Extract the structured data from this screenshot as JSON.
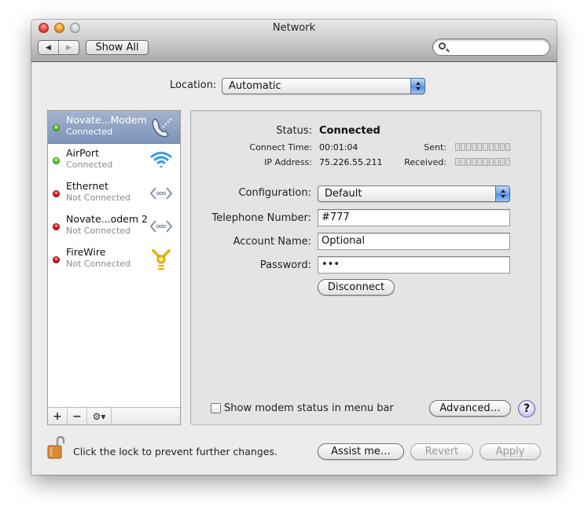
{
  "window": {
    "title": "Network",
    "controls": [
      "close",
      "minimize",
      "zoom"
    ]
  },
  "toolbar": {
    "back_icon": "◀",
    "forward_icon": "▶",
    "show_all_label": "Show All",
    "search": {
      "value": "",
      "placeholder": "",
      "icon": "search-icon"
    }
  },
  "location": {
    "label": "Location:",
    "selected": "Automatic"
  },
  "services": [
    {
      "name": "Novate...Modem",
      "status": "Connected",
      "indicator": "green",
      "icon": "modem-phone-icon",
      "selected": true
    },
    {
      "name": "AirPort",
      "status": "Connected",
      "indicator": "green",
      "icon": "wifi-icon",
      "selected": false
    },
    {
      "name": "Ethernet",
      "status": "Not Connected",
      "indicator": "red",
      "icon": "ethernet-icon",
      "selected": false
    },
    {
      "name": "Novate...odem 2",
      "status": "Not Connected",
      "indicator": "red",
      "icon": "ethernet-icon",
      "selected": false
    },
    {
      "name": "FireWire",
      "status": "Not Connected",
      "indicator": "red",
      "icon": "firewire-icon",
      "selected": false
    }
  ],
  "sidebar_toolbar": {
    "add": "+",
    "remove": "−",
    "action": "⚙▾"
  },
  "detail": {
    "status_label": "Status:",
    "status_value": "Connected",
    "connect_time_label": "Connect Time:",
    "connect_time_value": "00:01:04",
    "ip_label": "IP Address:",
    "ip_value": "75.226.55.211",
    "sent_label": "Sent:",
    "received_label": "Received:",
    "sent_level": 0,
    "received_level": 0,
    "configuration_label": "Configuration:",
    "configuration_value": "Default",
    "telephone_label": "Telephone Number:",
    "telephone_value": "#777",
    "account_label": "Account Name:",
    "account_value": "Optional",
    "password_label": "Password:",
    "password_value": "•••",
    "disconnect_label": "Disconnect",
    "show_status_label": "Show modem status in menu bar",
    "show_status_checked": false,
    "advanced_label": "Advanced…",
    "help_label": "?"
  },
  "footer": {
    "lock_text": "Click the lock to prevent further changes.",
    "lock_state": "unlocked",
    "assist_label": "Assist me…",
    "revert_label": "Revert",
    "apply_label": "Apply"
  },
  "colors": {
    "selection": "#8b9fc2",
    "connected": "#58c82c",
    "not_connected": "#e01818",
    "popup_accent": "#6fa2e3"
  }
}
